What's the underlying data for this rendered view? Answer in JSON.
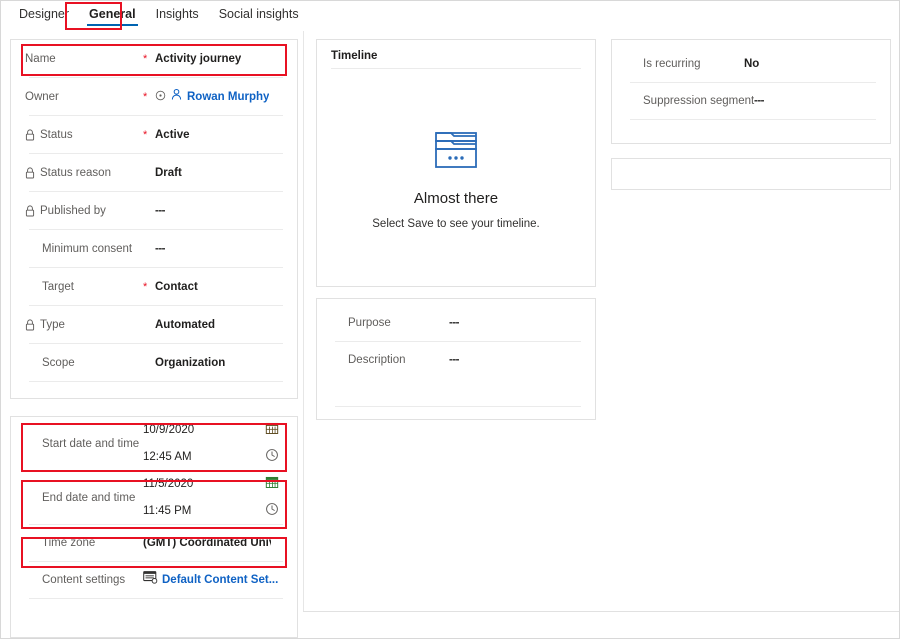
{
  "tabs": [
    {
      "label": "Designer",
      "selected": false
    },
    {
      "label": "General",
      "selected": true
    },
    {
      "label": "Insights",
      "selected": false
    },
    {
      "label": "Social insights",
      "selected": false
    }
  ],
  "colors": {
    "accent": "#0063b1",
    "link": "#0f62c4",
    "highlight": "#e81123",
    "label": "#605e5c",
    "value": "#201f1e"
  },
  "left_card_main": {
    "rows": [
      {
        "label": "Name",
        "locked": false,
        "required": true,
        "value": "Activity journey",
        "kind": "text"
      },
      {
        "label": "Owner",
        "locked": false,
        "required": true,
        "value": "Rowan Murphy",
        "kind": "owner"
      },
      {
        "label": "Status",
        "locked": true,
        "required": true,
        "value": "Active",
        "kind": "text"
      },
      {
        "label": "Status reason",
        "locked": true,
        "required": false,
        "value": "Draft",
        "kind": "text"
      },
      {
        "label": "Published by",
        "locked": true,
        "required": false,
        "value": "---",
        "kind": "text"
      },
      {
        "label": "Minimum consent",
        "locked": false,
        "required": false,
        "value": "---",
        "kind": "text"
      },
      {
        "label": "Target",
        "locked": false,
        "required": true,
        "value": "Contact",
        "kind": "text"
      },
      {
        "label": "Type",
        "locked": true,
        "required": false,
        "value": "Automated",
        "kind": "text"
      },
      {
        "label": "Scope",
        "locked": false,
        "required": false,
        "value": "Organization",
        "kind": "text"
      }
    ]
  },
  "left_card_schedule": {
    "start": {
      "label": "Start date and time",
      "date": "10/9/2020",
      "time": "12:45 AM",
      "date_icon": "calendar-icon",
      "time_icon": "clock-icon"
    },
    "end": {
      "label": "End date and time",
      "date": "11/5/2020",
      "time": "11:45 PM",
      "date_icon": "calendar-icon",
      "time_icon": "clock-icon"
    },
    "timezone": {
      "label": "Time zone",
      "value": "(GMT) Coordinated Universal Time"
    },
    "content_settings": {
      "label": "Content settings",
      "value": "Default Content Set...",
      "icon": "content-settings-icon"
    }
  },
  "timeline_card": {
    "title": "Timeline",
    "empty_icon": "timeline-folder-icon",
    "empty_heading": "Almost there",
    "empty_subtext": "Select Save to see your timeline."
  },
  "purpose_card": {
    "rows": [
      {
        "label": "Purpose",
        "value": "---"
      },
      {
        "label": "Description",
        "value": "---"
      }
    ]
  },
  "recurrence_card": {
    "rows": [
      {
        "label": "Is recurring",
        "value": "No"
      },
      {
        "label": "Suppression segment",
        "value": "---"
      }
    ]
  },
  "empty_card": {
    "content": ""
  }
}
